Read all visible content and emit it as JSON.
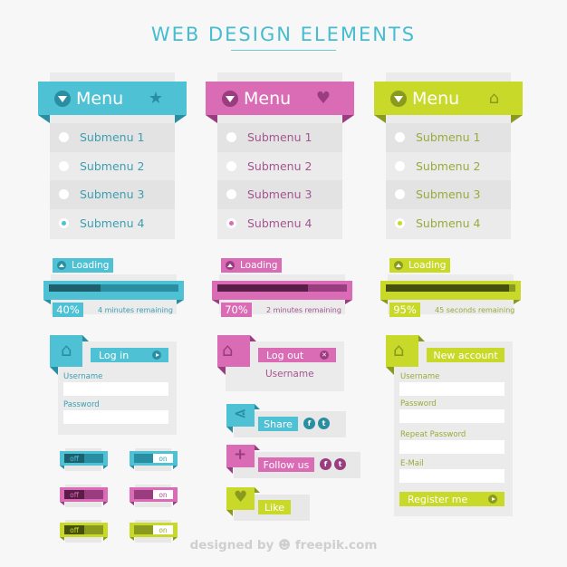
{
  "title": "WEB DESIGN ELEMENTS",
  "colors": {
    "blue": "#4fc1d4",
    "blue_dark": "#2a8ea3",
    "blue_text": "#3a9fb2",
    "pink": "#d96cb4",
    "pink_dark": "#9a3c80",
    "pink_text": "#a3558f",
    "green": "#c8d92a",
    "green_dark": "#8a9a1e",
    "green_text": "#9aaa3a",
    "panel": "#ebebeb",
    "background": "#f7f7f7"
  },
  "menus": [
    {
      "theme": "blue",
      "label": "Menu",
      "icon": "star-icon",
      "icon_glyph": "★",
      "items": [
        "Submenu 1",
        "Submenu 2",
        "Submenu 3",
        "Submenu 4"
      ],
      "selected_index": 3
    },
    {
      "theme": "pink",
      "label": "Menu",
      "icon": "heart-icon",
      "icon_glyph": "♥",
      "items": [
        "Submenu 1",
        "Submenu 2",
        "Submenu 3",
        "Submenu 4"
      ],
      "selected_index": 3
    },
    {
      "theme": "green",
      "label": "Menu",
      "icon": "home-icon",
      "icon_glyph": "⌂",
      "items": [
        "Submenu 1",
        "Submenu 2",
        "Submenu 3",
        "Submenu 4"
      ],
      "selected_index": 3
    }
  ],
  "loaders": [
    {
      "theme": "blue",
      "label": "Loading",
      "percent_label": "40%",
      "progress": 0.4,
      "remaining": "4 minutes remaining"
    },
    {
      "theme": "pink",
      "label": "Loading",
      "percent_label": "70%",
      "progress": 0.7,
      "remaining": "2 minutes remaining"
    },
    {
      "theme": "green",
      "label": "Loading",
      "percent_label": "95%",
      "progress": 0.95,
      "remaining": "45 seconds remaining"
    }
  ],
  "login": {
    "button": "Log in",
    "username_label": "Username",
    "password_label": "Password",
    "username_value": "",
    "password_value": ""
  },
  "logout": {
    "button": "Log out",
    "username": "Username"
  },
  "register": {
    "title": "New account",
    "username_label": "Username",
    "password_label": "Password",
    "repeat_label": "Repeat Password",
    "email_label": "E-Mail",
    "submit": "Register me",
    "username_value": "",
    "password_value": "",
    "repeat_value": "",
    "email_value": ""
  },
  "social": [
    {
      "theme": "blue",
      "label": "Share",
      "icon": "share-icon",
      "icon_glyph": "⋖",
      "networks": [
        "f",
        "t"
      ]
    },
    {
      "theme": "pink",
      "label": "Follow us",
      "icon": "plus-icon",
      "icon_glyph": "+",
      "networks": [
        "f",
        "t"
      ]
    },
    {
      "theme": "green",
      "label": "Like",
      "icon": "heart-icon",
      "icon_glyph": "♥",
      "networks": []
    }
  ],
  "toggles": [
    {
      "theme": "blue",
      "state": "off",
      "label": "off"
    },
    {
      "theme": "blue",
      "state": "on",
      "label": "on"
    },
    {
      "theme": "pink",
      "state": "off",
      "label": "off"
    },
    {
      "theme": "pink",
      "state": "on",
      "label": "on"
    },
    {
      "theme": "green",
      "state": "off",
      "label": "off"
    },
    {
      "theme": "green",
      "state": "on",
      "label": "on"
    }
  ],
  "credit": {
    "prefix": "designed by",
    "brand": "freepik.com"
  }
}
